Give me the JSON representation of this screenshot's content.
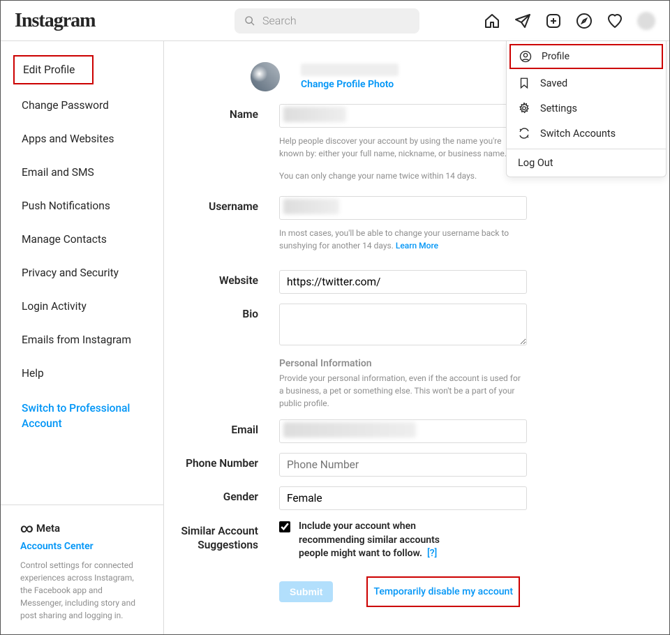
{
  "header": {
    "logo": "Instagram",
    "search_placeholder": "Search"
  },
  "dropdown": {
    "profile": "Profile",
    "saved": "Saved",
    "settings": "Settings",
    "switch": "Switch Accounts",
    "logout": "Log Out"
  },
  "sidebar": {
    "items": [
      "Edit Profile",
      "Change Password",
      "Apps and Websites",
      "Email and SMS",
      "Push Notifications",
      "Manage Contacts",
      "Privacy and Security",
      "Login Activity",
      "Emails from Instagram",
      "Help"
    ],
    "switch_pro": "Switch to Professional Account"
  },
  "meta": {
    "brand": "Meta",
    "center": "Accounts Center",
    "desc": "Control settings for connected experiences across Instagram, the Facebook app and Messenger, including story and post sharing and logging in."
  },
  "form": {
    "change_photo": "Change Profile Photo",
    "name_label": "Name",
    "name_help1": "Help people discover your account by using the name you're known by: either your full name, nickname, or business name.",
    "name_help2": "You can only change your name twice within 14 days.",
    "username_label": "Username",
    "username_help": "In most cases, you'll be able to change your username back to sunshying for another 14 days.",
    "learn_more": "Learn More",
    "website_label": "Website",
    "website_value": "https://twitter.com/",
    "bio_label": "Bio",
    "personal_head": "Personal Information",
    "personal_desc": "Provide your personal information, even if the account is used for a business, a pet or something else. This won't be a part of your public profile.",
    "email_label": "Email",
    "phone_label": "Phone Number",
    "phone_placeholder": "Phone Number",
    "gender_label": "Gender",
    "gender_value": "Female",
    "similar_label": "Similar Account Suggestions",
    "similar_text": "Include your account when recommending similar accounts people might want to follow.",
    "similar_q": "[?]",
    "submit": "Submit",
    "disable": "Temporarily disable my account"
  }
}
